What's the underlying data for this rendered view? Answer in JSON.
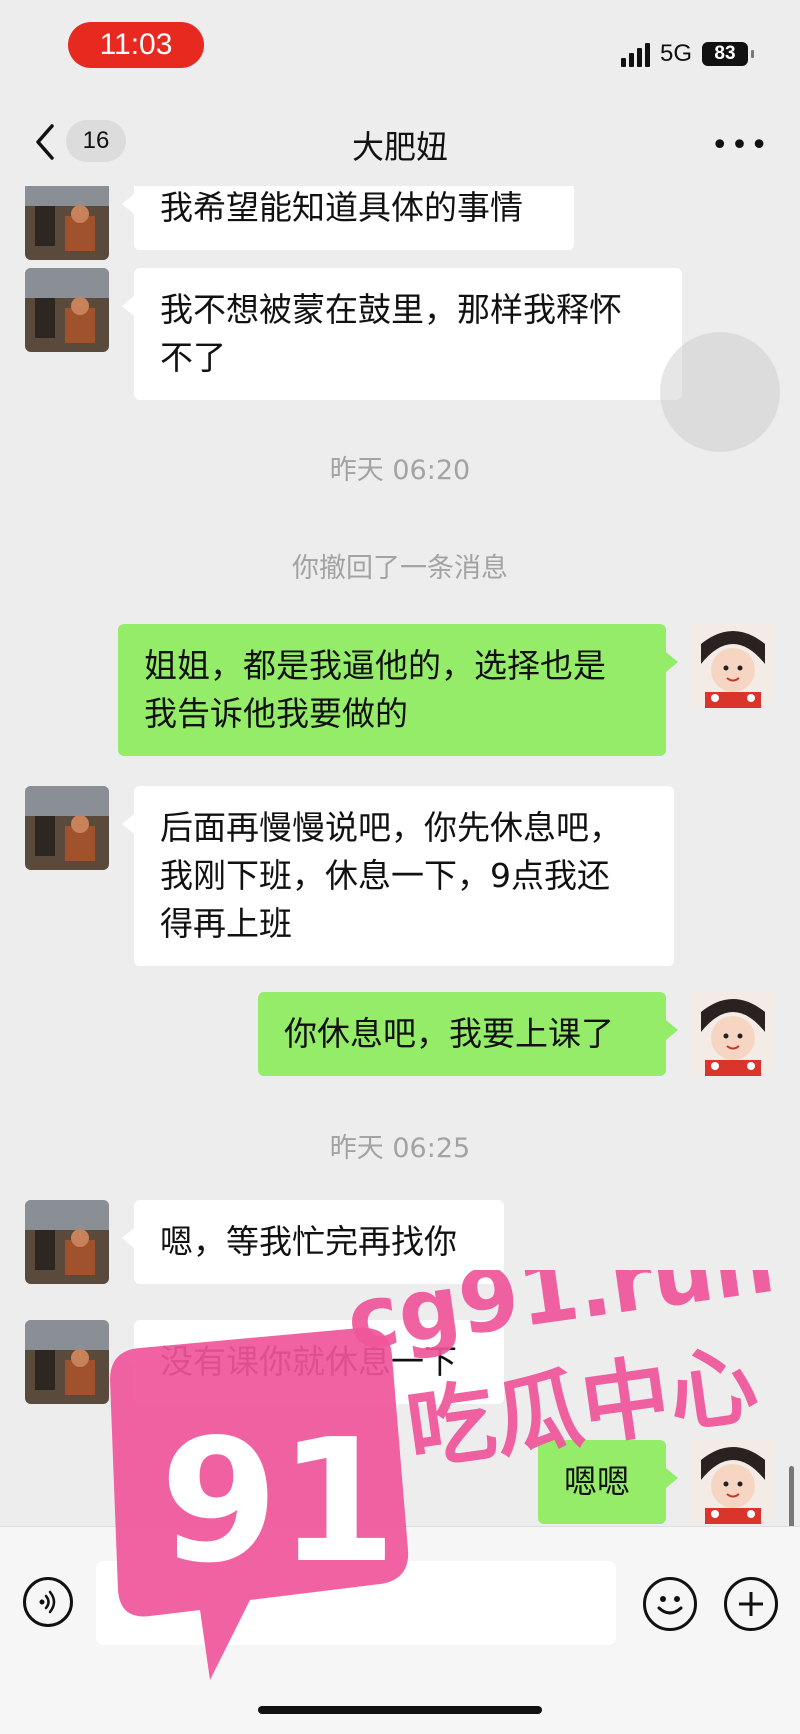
{
  "status_bar": {
    "time": "11:03",
    "network": "5G",
    "battery": "83"
  },
  "header": {
    "unread_count": "16",
    "title": "大肥妞",
    "more_label": "•••"
  },
  "messages": {
    "m1": "我希望能知道具体的事情",
    "m2_line1": "我不想被蒙在鼓里，那样我释怀",
    "m2_line2": "不了",
    "ts1": "昨天 06:20",
    "recall": "你撤回了一条消息",
    "m3_line1": "姐姐，都是我逼他的，选择也是",
    "m3_line2": "我告诉他我要做的",
    "m4_line1": "后面再慢慢说吧，你先休息吧，",
    "m4_line2": "我刚下班，休息一下，9点我还",
    "m4_line3": "得再上班",
    "m5": "你休息吧，我要上课了",
    "ts2": "昨天 06:25",
    "m6": "嗯，等我忙完再找你",
    "m7": "没有课你就休息一下",
    "m8": "嗯嗯"
  },
  "watermark": {
    "number": "91",
    "domain": "cg91.run",
    "name": "吃瓜中心"
  },
  "colors": {
    "time_pill": "#e8291f",
    "outgoing_bubble": "#95ec69",
    "watermark_pink": "#f0559a"
  },
  "icons": [
    "back-chevron-icon",
    "more-icon",
    "voice-icon",
    "emoji-icon",
    "plus-icon"
  ]
}
